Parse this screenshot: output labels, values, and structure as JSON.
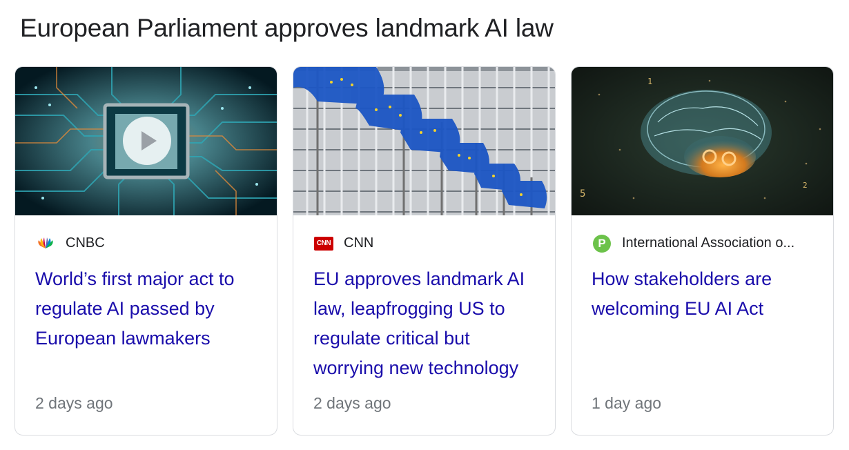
{
  "section": {
    "title": "European Parliament approves landmark AI law"
  },
  "cards": [
    {
      "source": "CNBC",
      "source_icon": "cnbc-peacock-icon",
      "headline": "World’s first major act to regulate AI passed by European lawmakers",
      "time": "2 days ago",
      "thumbnail": "circuit-chip-image",
      "has_video": true
    },
    {
      "source": "CNN",
      "source_icon": "cnn-logo-icon",
      "source_icon_text": "CNN",
      "headline": "EU approves landmark AI law, leapfrogging US to regulate critical but worrying new technology",
      "time": "2 days ago",
      "thumbnail": "eu-flags-building-image",
      "has_video": false
    },
    {
      "source": "International Association o...",
      "source_icon": "iapp-logo-icon",
      "source_icon_text": "P",
      "headline": "How stakeholders are welcoming EU AI Act",
      "time": "1 day ago",
      "thumbnail": "digital-brain-image",
      "has_video": false
    }
  ],
  "colors": {
    "headline": "#1a0dab",
    "meta": "#70757a",
    "title": "#202124",
    "border": "#dadce0"
  }
}
